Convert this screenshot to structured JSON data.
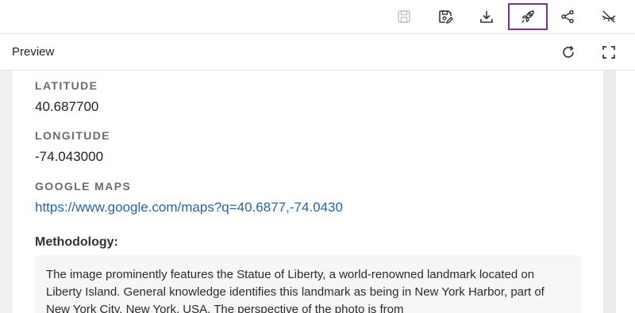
{
  "toolbar": {
    "icons": [
      "save-disabled-icon",
      "save-edit-icon",
      "download-icon",
      "rocket-icon",
      "share-icon",
      "hide-icon"
    ],
    "active_icon": "rocket-icon",
    "active_color": "#7b2c8f"
  },
  "preview": {
    "title": "Preview",
    "icons": [
      "refresh-icon",
      "fullscreen-icon"
    ]
  },
  "fields": {
    "latitude_label": "LATITUDE",
    "latitude_value": "40.687700",
    "longitude_label": "LONGITUDE",
    "longitude_value": "-74.043000",
    "maps_label": "GOOGLE MAPS",
    "maps_url": "https://www.google.com/maps?q=40.6877,-74.0430"
  },
  "methodology": {
    "title": "Methodology:",
    "text": "The image prominently features the Statue of Liberty, a world-renowned landmark located on Liberty Island. General knowledge identifies this landmark as being in New York Harbor, part of New York City, New York, USA. The perspective of the photo is from"
  },
  "colors": {
    "link": "#2a62a8",
    "label": "#6b6b6b"
  }
}
